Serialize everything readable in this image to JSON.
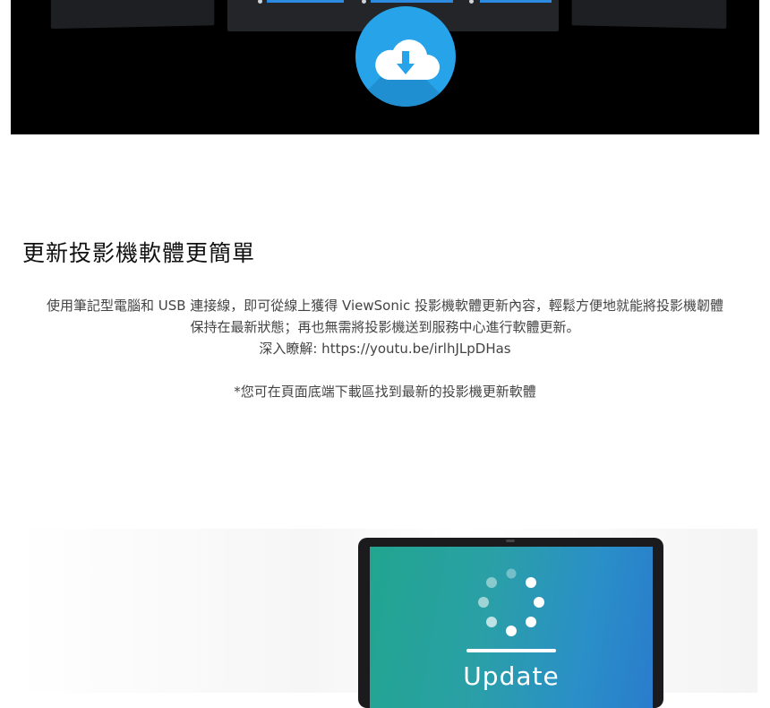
{
  "hero": {
    "icon": "cloud-download-icon",
    "accent": "#27a3ea",
    "background": "#000000"
  },
  "section": {
    "title": "更新投影機軟體更簡單",
    "lines": [
      "使用筆記型電腦和 USB 連接線，即可從線上獲得 ViewSonic 投影機軟體更新內容，輕鬆方便地就能將投影機韌體",
      "保持在最新狀態；再也無需將投影機送到服務中心進行軟體更新。",
      "深入瞭解: https://youtu.be/irlhJLpDHas"
    ],
    "note": "*您可在頁面底端下載區找到最新的投影機更新軟體"
  },
  "laptop": {
    "screen_label": "Update",
    "icon": "loading-spinner-icon",
    "screen_colors": [
      "#21a58f",
      "#2a7ccc"
    ]
  }
}
